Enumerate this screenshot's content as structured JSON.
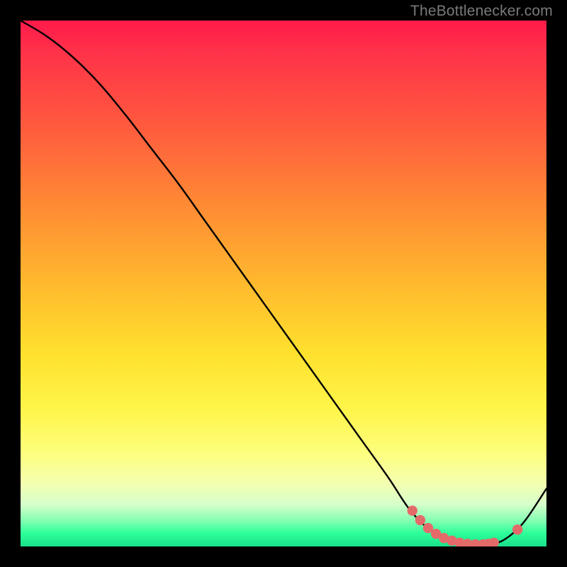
{
  "watermark": "TheBottlenecker.com",
  "chart_data": {
    "type": "line",
    "title": "",
    "xlabel": "",
    "ylabel": "",
    "xlim": [
      0,
      100
    ],
    "ylim": [
      0,
      100
    ],
    "series": [
      {
        "name": "bottleneck-curve",
        "x": [
          0,
          5,
          10,
          15,
          20,
          25,
          30,
          35,
          40,
          45,
          50,
          55,
          60,
          65,
          70,
          74,
          78,
          82,
          86,
          90,
          93,
          96,
          100
        ],
        "y": [
          100,
          97,
          93,
          88,
          82,
          75.5,
          69,
          62,
          55,
          48,
          41,
          34,
          27,
          20,
          13,
          7,
          3,
          1,
          0.3,
          0.5,
          2,
          5,
          11
        ]
      }
    ],
    "markers": {
      "name": "highlight-points",
      "color": "#e46a6a",
      "x": [
        74.5,
        76,
        77.5,
        79,
        80.5,
        82,
        83.5,
        85,
        86.5,
        88,
        89,
        90,
        94.5
      ],
      "y": [
        6.8,
        5.0,
        3.5,
        2.4,
        1.6,
        1.1,
        0.7,
        0.5,
        0.4,
        0.4,
        0.5,
        0.7,
        3.2
      ]
    }
  }
}
